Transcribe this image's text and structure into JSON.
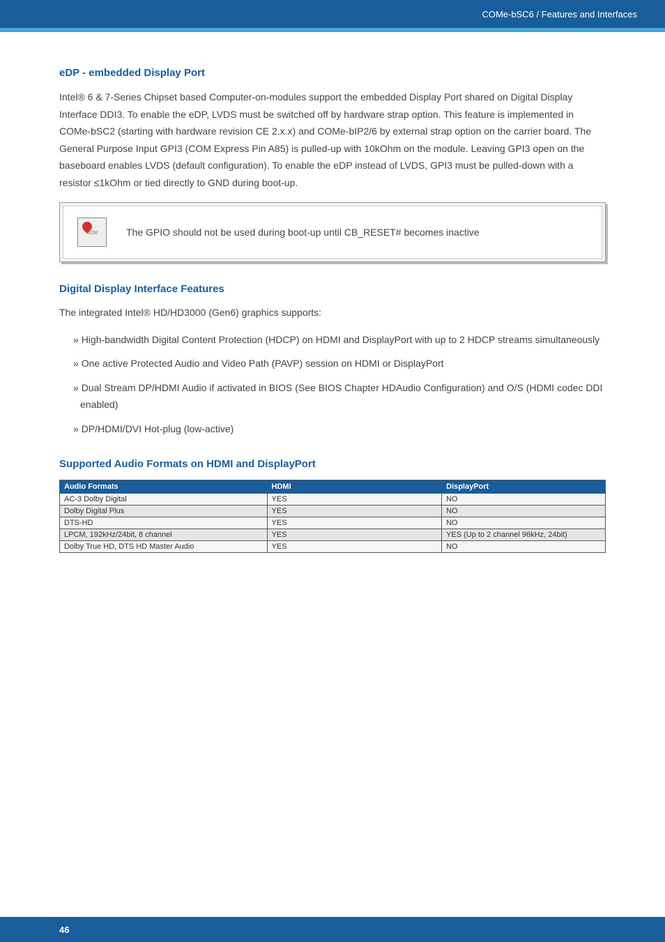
{
  "header": {
    "breadcrumb": "COMe-bSC6 / Features and Interfaces"
  },
  "sections": {
    "edp": {
      "title": "eDP - embedded Display Port",
      "body": "Intel® 6 & 7-Series Chipset based Computer-on-modules support the embedded Display Port shared on Digital Display Interface DDI3. To enable the eDP, LVDS must be switched off by hardware strap option. This feature is implemented in COMe-bSC2 (starting with hardware revision CE 2.x.x) and COMe-bIP2/6 by external strap option on the carrier board. The General Purpose Input GPI3 (COM Express Pin A85) is pulled-up with 10kOhm on the module. Leaving GPI3 open on the baseboard enables LVDS (default configuration). To enable the eDP instead of LVDS, GPI3 must be pulled-down with a resistor ≤1kOhm or tied directly to GND during boot-up."
    },
    "note": {
      "icon_label": "note",
      "text": "The GPIO should not be used during boot-up until CB_RESET# becomes inactive"
    },
    "ddi": {
      "title": "Digital Display Interface Features",
      "intro": "The integrated Intel® HD/HD3000 (Gen6) graphics supports:",
      "items": [
        "High-bandwidth Digital Content Protection (HDCP) on HDMI and DisplayPort with up to 2 HDCP streams simultaneously",
        "One active Protected Audio and Video Path (PAVP) session on HDMI or DisplayPort",
        "Dual Stream DP/HDMI Audio if activated in BIOS (See BIOS Chapter HDAudio Configuration) and O/S (HDMI codec DDI enabled)",
        "DP/HDMI/DVI Hot-plug (low-active)"
      ]
    },
    "audio": {
      "title": "Supported Audio Formats on HDMI and DisplayPort",
      "headers": [
        "Audio Formats",
        "HDMI",
        "DisplayPort"
      ],
      "rows": [
        [
          "AC-3 Dolby Digital",
          "YES",
          "NO"
        ],
        [
          "Dolby Digital Plus",
          "YES",
          "NO"
        ],
        [
          "DTS-HD",
          "YES",
          "NO"
        ],
        [
          "LPCM, 192kHz/24bit, 8 channel",
          "YES",
          "YES (Up to 2 channel 96kHz, 24bit)"
        ],
        [
          "Dolby True HD, DTS HD Master Audio",
          "YES",
          "NO"
        ]
      ]
    }
  },
  "footer": {
    "page": "46"
  }
}
